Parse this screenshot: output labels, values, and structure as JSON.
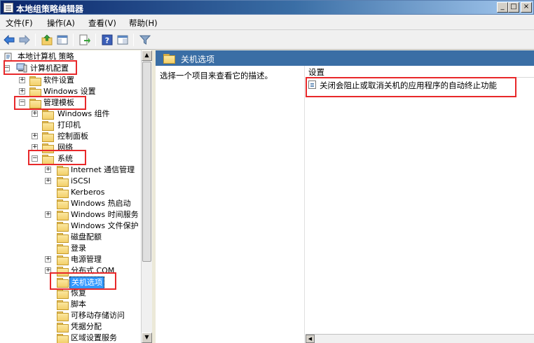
{
  "window": {
    "title": "本地组策略编辑器"
  },
  "menu": [
    {
      "label": "文件(F)"
    },
    {
      "label": "操作(A)"
    },
    {
      "label": "查看(V)"
    },
    {
      "label": "帮助(H)"
    }
  ],
  "toolbar": {
    "icons": [
      "back-arrow-icon",
      "forward-arrow-icon",
      "up-folder-icon",
      "show-hide-tree-icon",
      "export-list-icon",
      "help-icon",
      "properties-icon",
      "filter-icon"
    ]
  },
  "tree": {
    "root": "本地计算机 策略",
    "computer_config": "计算机配置",
    "software_settings": "软件设置",
    "windows_settings": "Windows 设置",
    "admin_templates": "管理模板",
    "windows_components": "Windows 组件",
    "printers": "打印机",
    "control_panel": "控制面板",
    "network": "网络",
    "system": "系统",
    "system_children": [
      "Internet 通信管理",
      "iSCSI",
      "Kerberos",
      "Windows 热启动",
      "Windows 时间服务",
      "Windows 文件保护",
      "磁盘配额",
      "登录",
      "电源管理",
      "分布式 COM",
      "关机选项",
      "恢复",
      "脚本",
      "可移动存储访问",
      "凭据分配",
      "区域设置服务"
    ]
  },
  "right_pane": {
    "header_title": "关机选项",
    "description": "选择一个项目来查看它的描述。",
    "column_header": "设置",
    "settings": [
      {
        "label": "关闭会阻止或取消关机的应用程序的自动终止功能"
      }
    ]
  },
  "colors": {
    "highlight": "#e8282a",
    "header_blue": "#3a6ea5",
    "selection": "#3399ff"
  }
}
